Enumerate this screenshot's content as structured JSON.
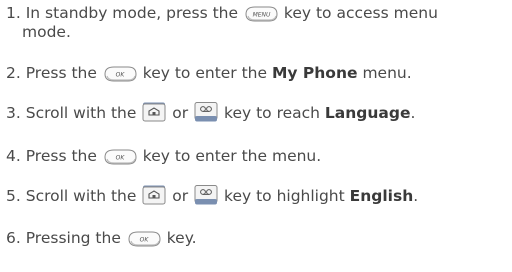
{
  "steps": [
    {
      "num": "1.",
      "a": "In standby mode, press the",
      "key": "menu-key",
      "key_label": "MENU",
      "b": "key to access menu",
      "c": "mode."
    },
    {
      "num": "2.",
      "a": "Press the",
      "key": "ok-key",
      "key_label": "OK",
      "b": "key to enter the",
      "bold": "My Phone",
      "c": "menu."
    },
    {
      "num": "3.",
      "a": "Scroll with the",
      "key1": "home-key",
      "mid": "or",
      "key2": "voicemail-key",
      "b": "key to reach",
      "bold": "Language",
      "c": "."
    },
    {
      "num": "4.",
      "a": "Press the",
      "key": "ok-key",
      "key_label": "OK",
      "b": "key to enter the menu."
    },
    {
      "num": "5.",
      "a": "Scroll with the",
      "key1": "home-key",
      "mid": "or",
      "key2": "voicemail-key",
      "b": "key to highlight",
      "bold": "English",
      "c": "."
    },
    {
      "num": "6.",
      "a": "Pressing the",
      "key": "ok-key",
      "key_label": "OK",
      "b": "key."
    }
  ]
}
